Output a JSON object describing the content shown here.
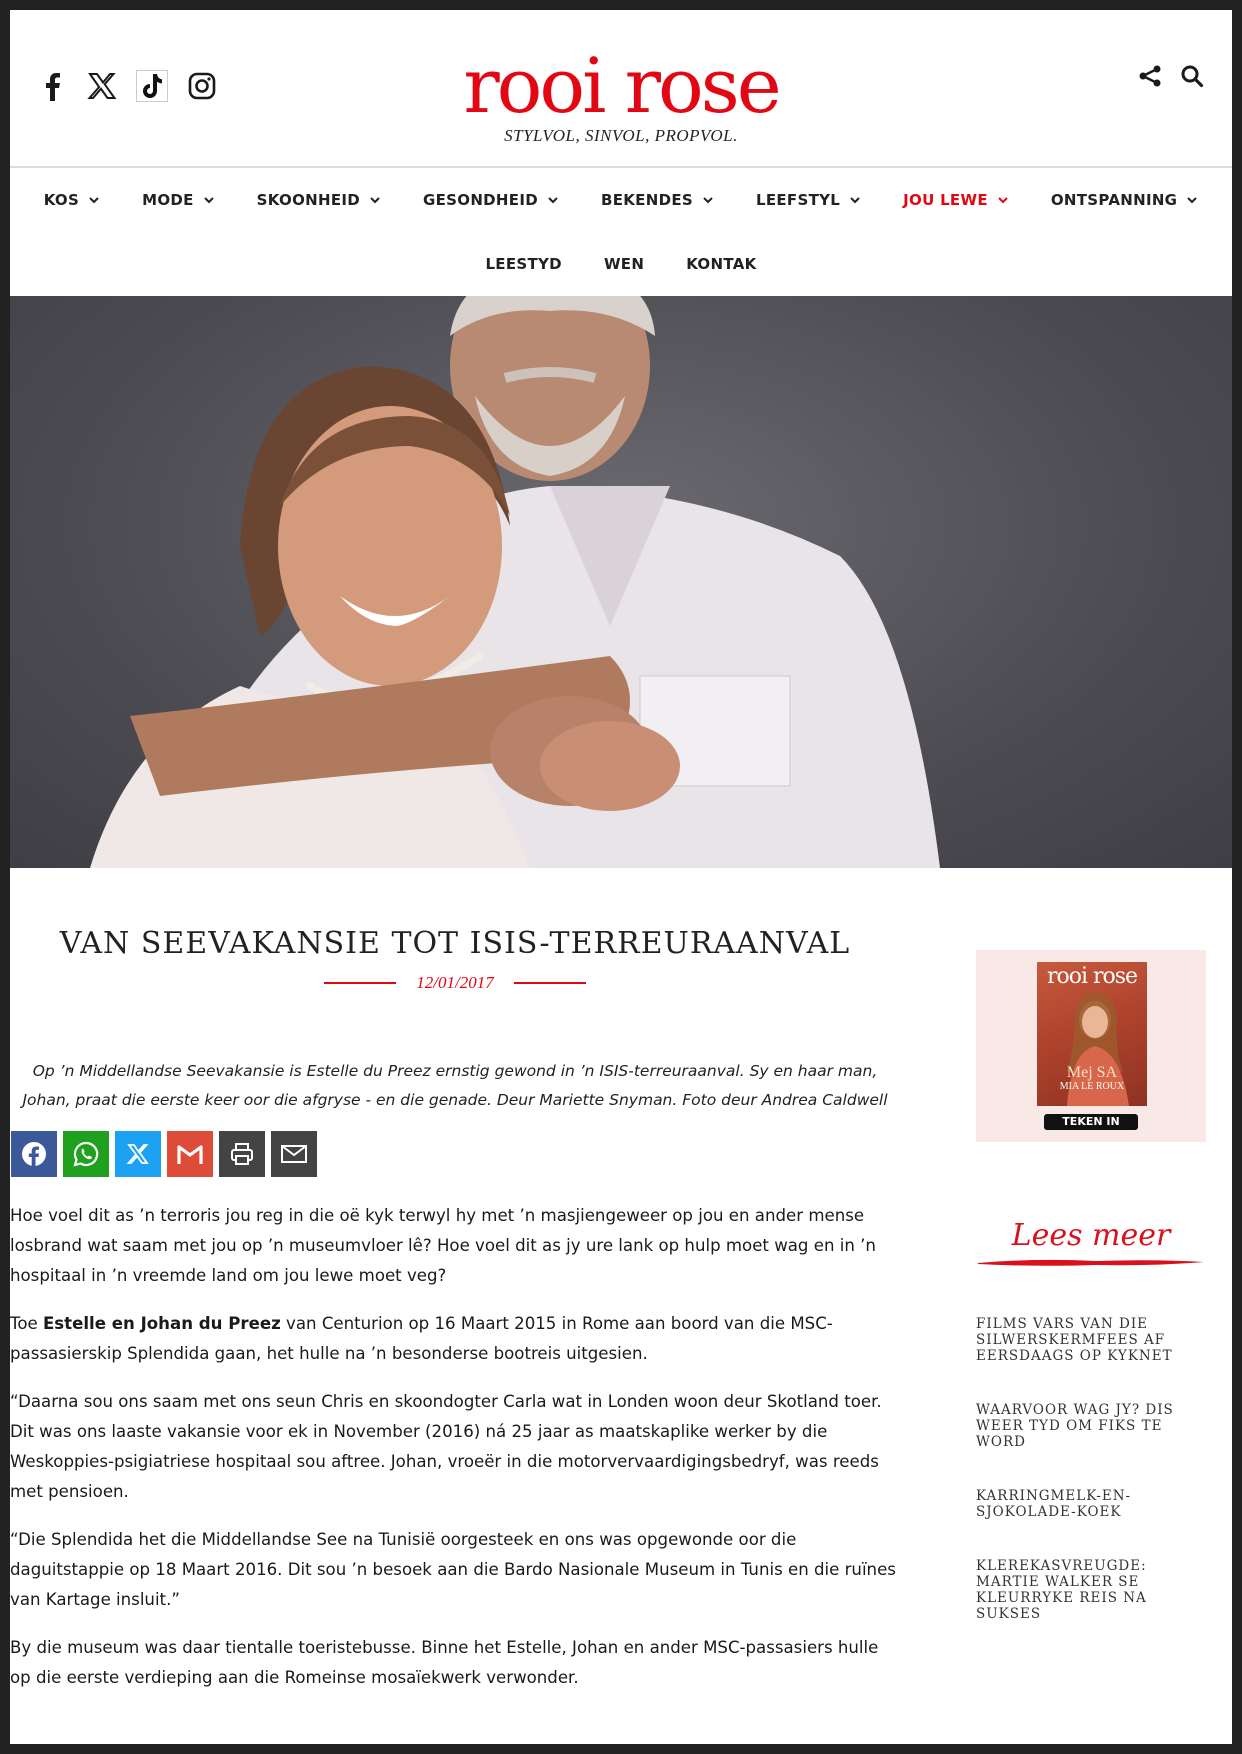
{
  "site": {
    "logo_text": "rooi rose",
    "tagline": "STYLVOL, SINVOL, PROPVOL.",
    "brand_color": "#e30613"
  },
  "social_icons": [
    "facebook-icon",
    "x-icon",
    "tiktok-icon",
    "instagram-icon"
  ],
  "nav": {
    "row1": [
      {
        "label": "KOS",
        "dropdown": true,
        "active": false
      },
      {
        "label": "MODE",
        "dropdown": true,
        "active": false
      },
      {
        "label": "SKOONHEID",
        "dropdown": true,
        "active": false
      },
      {
        "label": "GESONDHEID",
        "dropdown": true,
        "active": false
      },
      {
        "label": "BEKENDES",
        "dropdown": true,
        "active": false
      },
      {
        "label": "LEEFSTYL",
        "dropdown": true,
        "active": false
      },
      {
        "label": "JOU LEWE",
        "dropdown": true,
        "active": true
      },
      {
        "label": "ONTSPANNING",
        "dropdown": true,
        "active": false
      }
    ],
    "row2": [
      {
        "label": "LEESTYD"
      },
      {
        "label": "WEN"
      },
      {
        "label": "KONTAK"
      }
    ]
  },
  "article": {
    "title": "VAN SEEVAKANSIE TOT ISIS-TERREURAANVAL",
    "date": "12/01/2017",
    "lead": "Op ’n Middellandse Seevakansie is Estelle du Preez ernstig gewond in ’n ISIS-terreuraanval. Sy en haar man, Johan, praat die eerste keer oor die afgryse - en die genade. Deur Mariette Snyman. Foto deur Andrea Caldwell",
    "share_buttons": [
      {
        "icon": "facebook-icon",
        "color": "#3b5998"
      },
      {
        "icon": "whatsapp-icon",
        "color": "#1fa11f"
      },
      {
        "icon": "x-icon",
        "color": "#1da1f2"
      },
      {
        "icon": "gmail-icon",
        "color": "#dd4b39"
      },
      {
        "icon": "print-icon",
        "color": "#444444"
      },
      {
        "icon": "email-icon",
        "color": "#444444"
      }
    ],
    "paragraphs": {
      "p1": "Hoe voel dit as ’n terroris jou reg in die oë kyk terwyl hy met ’n masjiengeweer op jou en ander mense losbrand wat saam met jou op ’n museumvloer lê? Hoe voel dit as jy ure lank op hulp moet wag en in ’n hospitaal in ’n vreemde land om jou lewe moet veg?",
      "p2_prefix": "Toe ",
      "p2_bold": "Estelle en Johan du Preez",
      "p2_suffix": " van Centurion op 16 Maart 2015 in Rome aan boord van die MSC-passasierskip Splendida gaan, het hulle na ’n besonderse bootreis uitgesien.",
      "p3": "“Daarna sou ons saam met ons seun Chris en skoondogter Carla wat in Londen woon deur Skotland toer. Dit was ons laaste vakansie voor ek in November (2016) ná 25 jaar as maatskaplike werker by die Weskoppies-psigiatriese hospitaal sou aftree. Johan, vroeër in die motorvervaardigingsbedryf, was reeds met pensioen.",
      "p4": "“Die Splendida het die Middellandse See na Tunisië oorgesteek en ons was opgewonde oor die daguitstappie op 18 Maart 2016. Dit sou ’n besoek aan die Bardo Nasionale Museum in Tunis en die ruïnes van Kartage insluit.”",
      "p5": "By die museum was daar tientalle toeristebusse. Binne het Estelle, Johan en ander MSC-passasiers hulle op die eerste verdieping aan die Romeinse mosaïekwerk verwonder."
    }
  },
  "sidebar": {
    "magazine_title": "rooi rose",
    "magazine_big": "Mej SA",
    "magazine_name": "MIA LE ROUX",
    "subscribe_label": "TEKEN IN",
    "lees_meer": "Lees meer",
    "related": [
      "FILMS VARS VAN DIE SILWERSKERMFEES AF EERSDAAGS OP KYKNET",
      "WAARVOOR WAG JY? DIS WEER TYD OM FIKS TE WORD",
      "KARRINGMELK-EN-SJOKOLADE-KOEK",
      "KLEREKASVREUGDE: MARTIE WALKER SE KLEURRYKE REIS NA SUKSES"
    ]
  }
}
